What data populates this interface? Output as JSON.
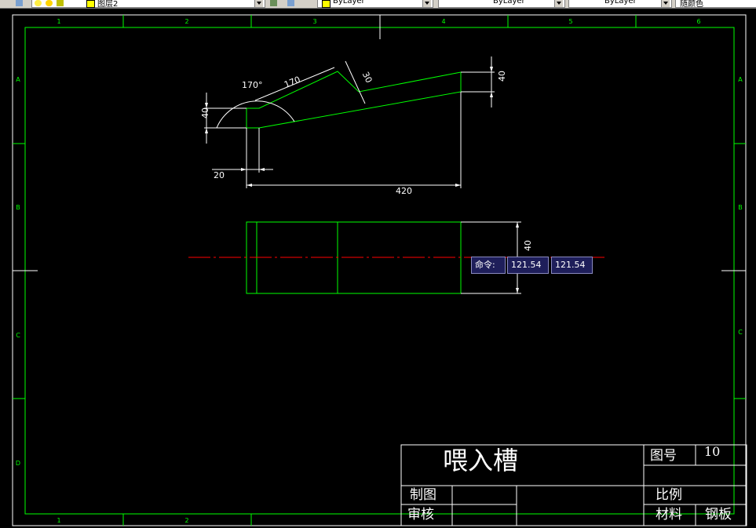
{
  "toolbar": {
    "layer_name": "图层2",
    "color_value": "ByLayer",
    "linetype_value": "ByLayer",
    "lineweight_value": "ByLayer",
    "plotstyle_value": "随颜色"
  },
  "colors": {
    "border": "#00ff00",
    "dimension": "#ffffff",
    "centerline": "#ff0000",
    "cmd_bg": "#1e1e5a"
  },
  "frame": {
    "columns_top": [
      "1",
      "2",
      "3",
      "4",
      "5",
      "6"
    ],
    "columns_bottom": [
      "1",
      "2"
    ],
    "rows_left": [
      "A",
      "B",
      "C",
      "D"
    ],
    "rows_right": [
      "A",
      "B",
      "C"
    ]
  },
  "dimensions": {
    "angle": "170°",
    "slope_length": "170",
    "notch": "30",
    "left_height": "40",
    "right_height": "40",
    "offset": "20",
    "total_length": "420",
    "section_height": "40"
  },
  "command": {
    "label": "命令:",
    "value1": "121.54",
    "value2": "121.54"
  },
  "title_block": {
    "title": "喂入槽",
    "drawing_no_label": "图号",
    "drawing_no_value": "10",
    "drawn_label": "制图",
    "checked_label": "审核",
    "scale_label": "比例",
    "material_label": "材料",
    "material_value": "钢板"
  }
}
